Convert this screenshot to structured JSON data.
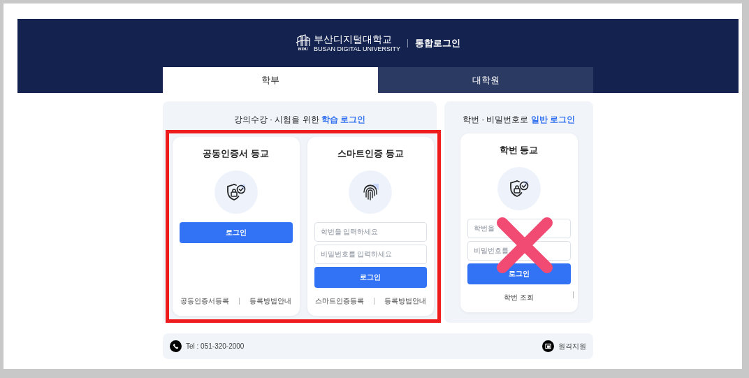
{
  "header": {
    "logo_mark": "BDU",
    "logo_name": "부산디지털대학교",
    "logo_sub": "BUSAN DIGITAL UNIVERSITY",
    "title": "통합로그인"
  },
  "tabs": [
    {
      "label": "학부",
      "selected": true
    },
    {
      "label": "대학원",
      "selected": false
    }
  ],
  "panels": [
    {
      "heading": "강의수강 · 시험을 위한",
      "heading_highlight": "학습 로그인",
      "highlighted": true,
      "cards": [
        {
          "kind": "certificate",
          "title": "공동인증서 등교",
          "button": "로그인",
          "links": [
            "공동인증서등록",
            "등록방법안내"
          ],
          "trailing_separator": false,
          "crossed": false
        },
        {
          "kind": "smart",
          "title": "스마트인증 등교",
          "fields": [
            {
              "placeholder": "학번을 입력하세요"
            },
            {
              "placeholder": "비밀번호를 입력하세요"
            }
          ],
          "button": "로그인",
          "links": [
            "스마트인증등록",
            "등록방법안내"
          ],
          "trailing_separator": false,
          "crossed": false
        }
      ]
    },
    {
      "heading": "학번 · 비밀번호로",
      "heading_highlight": "일반 로그인",
      "highlighted": false,
      "cards": [
        {
          "kind": "student_id",
          "title": "학번 등교",
          "fields": [
            {
              "placeholder": "학번을"
            },
            {
              "placeholder": "비밀번호를"
            }
          ],
          "button": "로그인",
          "links": [
            "학번 조회"
          ],
          "trailing_separator": true,
          "crossed": true
        }
      ]
    }
  ],
  "footer": {
    "phone": "Tel : 051-320-2000",
    "remote": "원격지원"
  }
}
